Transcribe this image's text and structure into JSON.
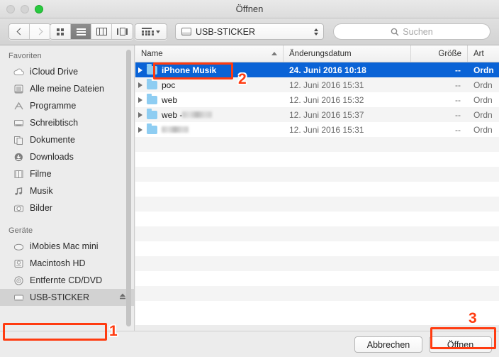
{
  "window": {
    "title": "Öffnen",
    "traffic_lights": [
      {
        "name": "close",
        "color": "#d4d4d4",
        "enabled": false
      },
      {
        "name": "minimize",
        "color": "#d4d4d4",
        "enabled": false
      },
      {
        "name": "zoom",
        "color": "#28c940",
        "enabled": true
      }
    ]
  },
  "toolbar": {
    "back_icon": "chevron-left-icon",
    "forward_icon": "chevron-right-icon",
    "view_modes": [
      {
        "name": "icon-view",
        "active": false
      },
      {
        "name": "list-view",
        "active": true
      },
      {
        "name": "column-view",
        "active": false
      },
      {
        "name": "gallery-view",
        "active": false
      }
    ],
    "arrange_icon": "arrange-icon",
    "path_popup": {
      "label": "USB-STICKER",
      "icon": "drive-icon"
    },
    "search": {
      "placeholder": "Suchen",
      "icon": "search-icon",
      "value": ""
    }
  },
  "sidebar": {
    "sections": [
      {
        "header": "Favoriten",
        "items": [
          {
            "label": "iCloud Drive",
            "icon": "cloud-icon",
            "selected": false
          },
          {
            "label": "Alle meine Dateien",
            "icon": "all-files-icon",
            "selected": false
          },
          {
            "label": "Programme",
            "icon": "applications-icon",
            "selected": false
          },
          {
            "label": "Schreibtisch",
            "icon": "desktop-icon",
            "selected": false
          },
          {
            "label": "Dokumente",
            "icon": "documents-icon",
            "selected": false
          },
          {
            "label": "Downloads",
            "icon": "downloads-icon",
            "selected": false
          },
          {
            "label": "Filme",
            "icon": "movies-icon",
            "selected": false
          },
          {
            "label": "Musik",
            "icon": "music-icon",
            "selected": false
          },
          {
            "label": "Bilder",
            "icon": "pictures-icon",
            "selected": false
          }
        ]
      },
      {
        "header": "Geräte",
        "items": [
          {
            "label": "iMobies Mac mini",
            "icon": "computer-icon",
            "selected": false
          },
          {
            "label": "Macintosh HD",
            "icon": "internal-drive-icon",
            "selected": false
          },
          {
            "label": "Entfernte CD/DVD",
            "icon": "disc-icon",
            "selected": false
          },
          {
            "label": "USB-STICKER",
            "icon": "external-drive-icon",
            "selected": true,
            "eject": true
          }
        ]
      }
    ]
  },
  "filelist": {
    "columns": [
      {
        "key": "name",
        "label": "Name",
        "sorted": true,
        "sort_dir": "asc"
      },
      {
        "key": "date",
        "label": "Änderungsdatum"
      },
      {
        "key": "size",
        "label": "Größe"
      },
      {
        "key": "kind",
        "label": "Art"
      }
    ],
    "rows": [
      {
        "name": "iPhone Musik",
        "name_redacted": false,
        "date": "24. Juni 2016 10:18",
        "size": "--",
        "kind": "Ordn",
        "selected": true
      },
      {
        "name": "poc",
        "name_redacted": false,
        "date": "12. Juni 2016 15:31",
        "size": "--",
        "kind": "Ordn",
        "selected": false
      },
      {
        "name": "web",
        "name_redacted": false,
        "date": "12. Juni 2016 15:32",
        "size": "--",
        "kind": "Ordn",
        "selected": false
      },
      {
        "name": "web - ",
        "name_redacted": true,
        "redact_width": 42,
        "date": "12. Juni 2016 15:37",
        "size": "--",
        "kind": "Ordn",
        "selected": false
      },
      {
        "name": "",
        "name_redacted": true,
        "redact_width": 38,
        "date": "12. Juni 2016 15:31",
        "size": "--",
        "kind": "Ordn",
        "selected": false
      }
    ]
  },
  "bottom": {
    "cancel_label": "Abbrechen",
    "open_label": "Öffnen"
  },
  "annotations": {
    "color": "#ff3b10",
    "markers": [
      {
        "number": "1",
        "target": "sidebar-item-usb-sticker"
      },
      {
        "number": "2",
        "target": "file-row-iphone-musik"
      },
      {
        "number": "3",
        "target": "open-button"
      }
    ]
  }
}
